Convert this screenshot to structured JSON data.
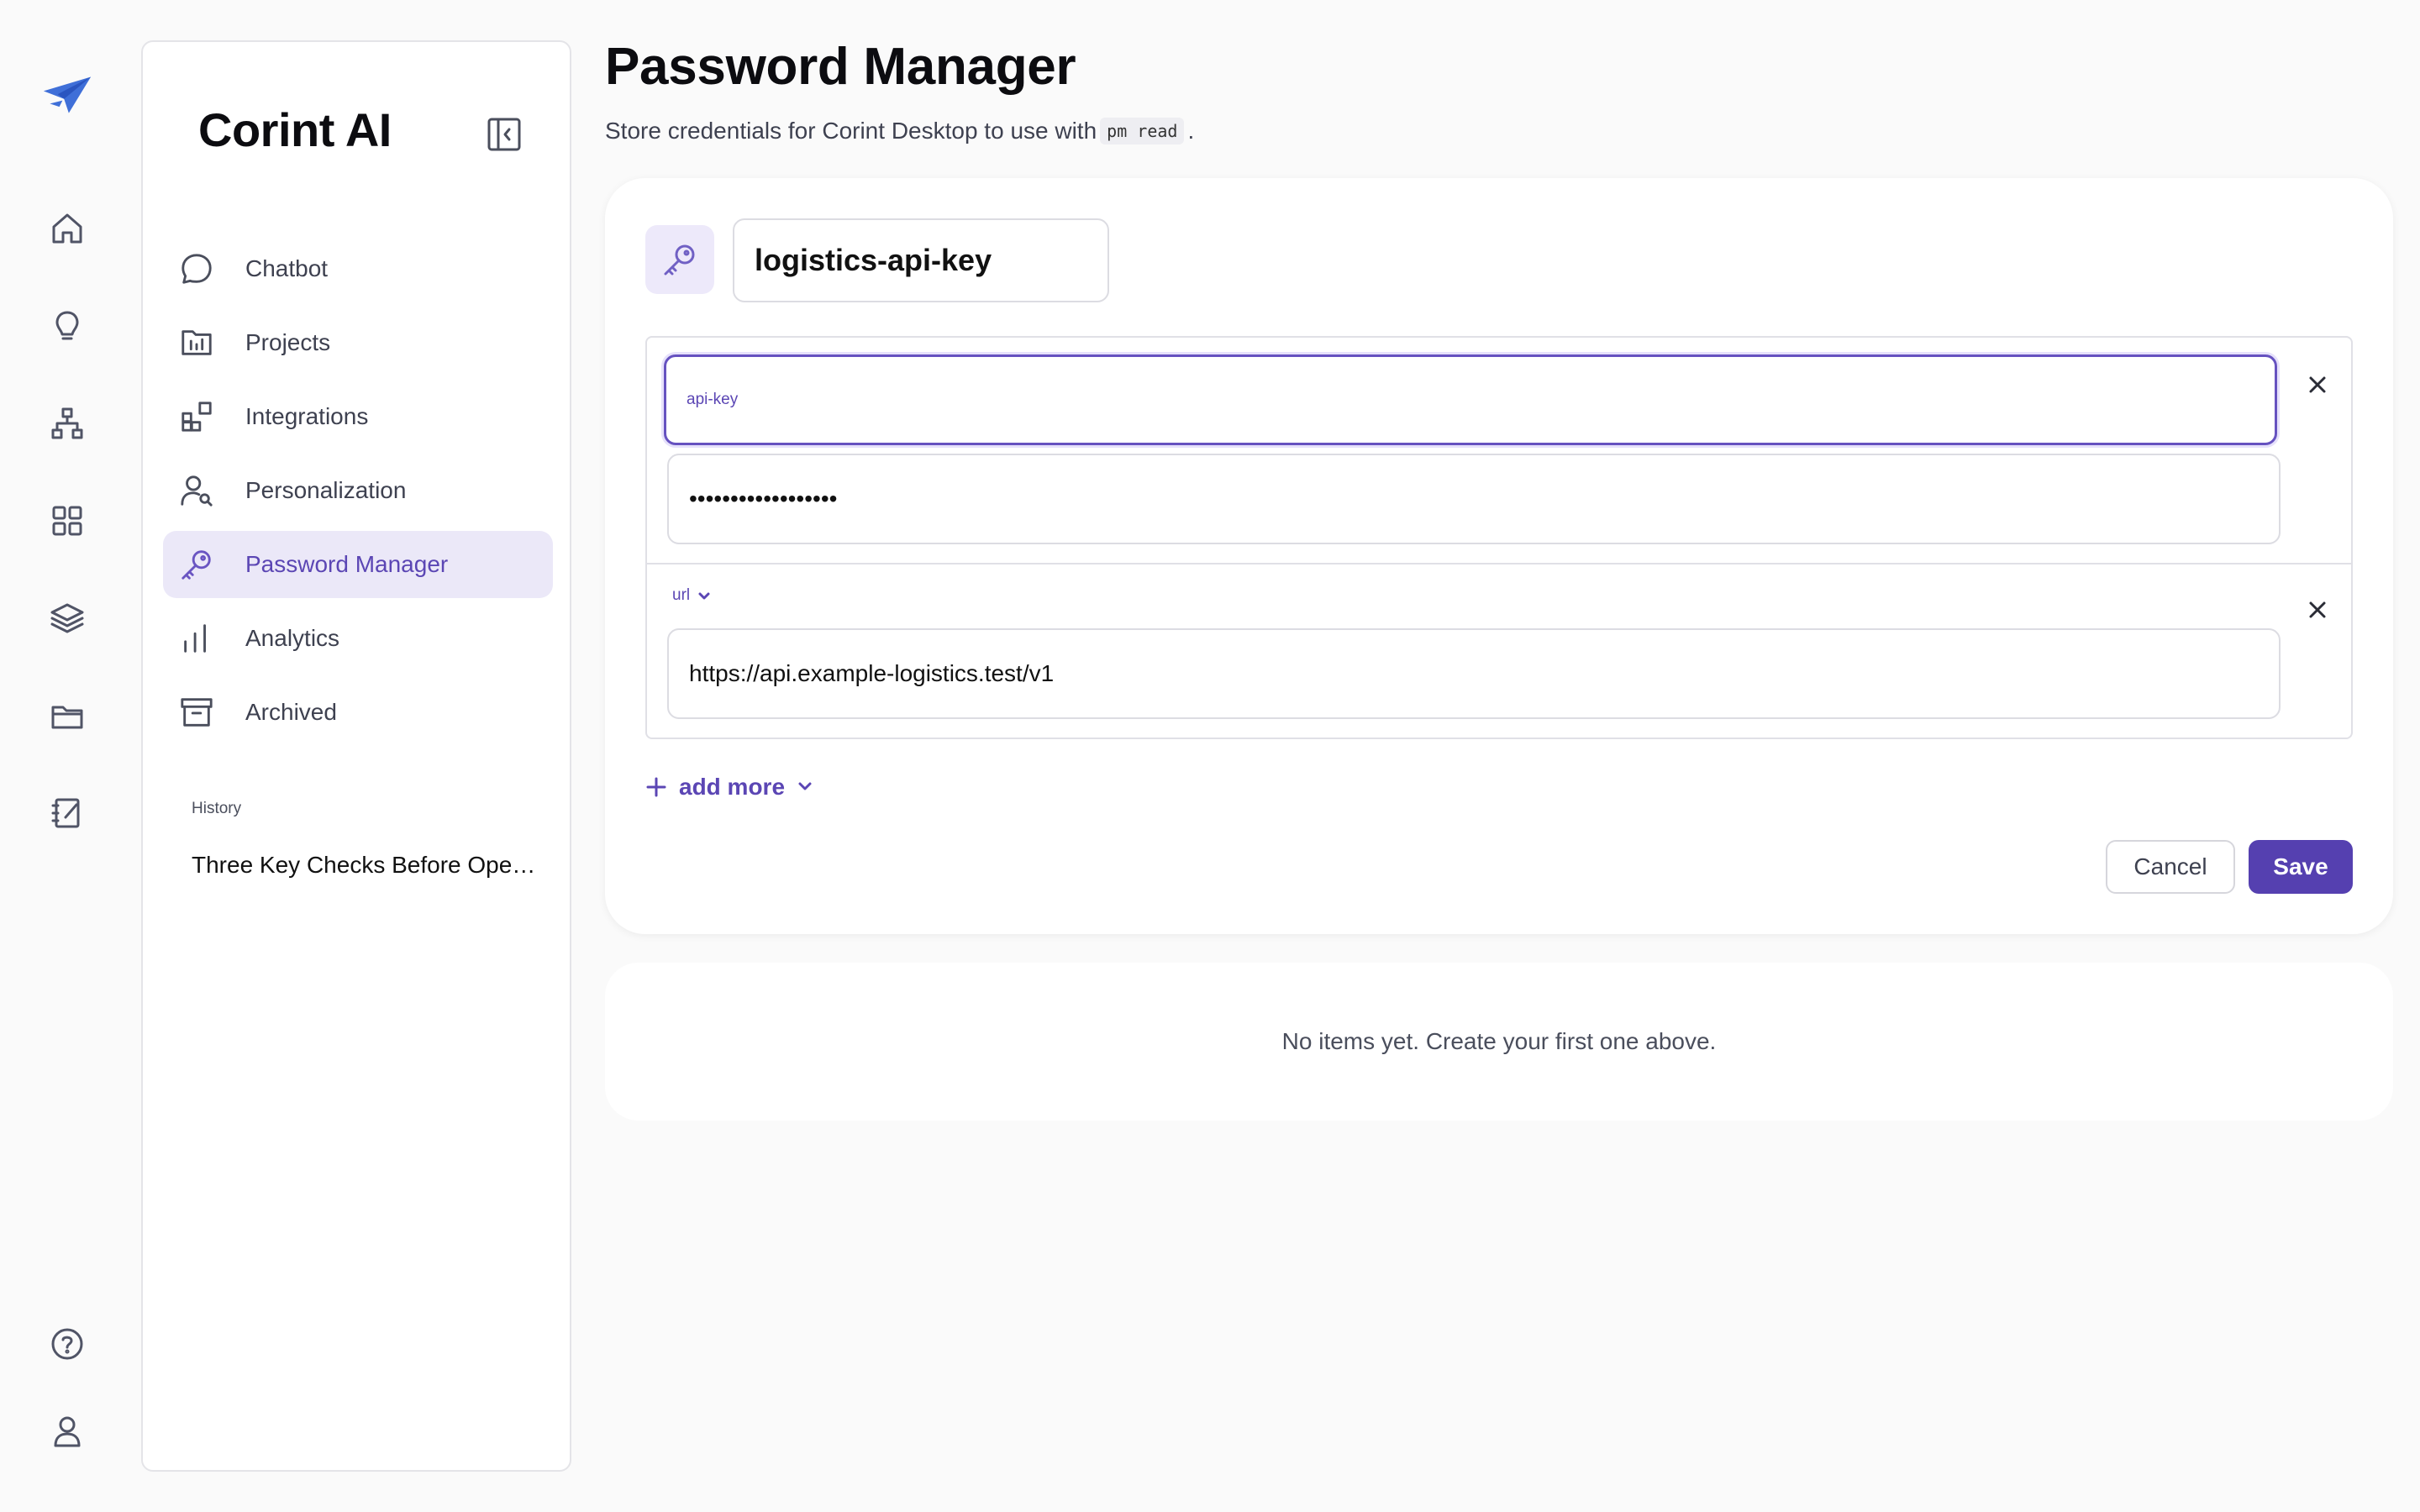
{
  "app": {
    "name": "Corint AI"
  },
  "rail": {
    "icons": [
      "logo-icon",
      "home-icon",
      "lightbulb-icon",
      "hierarchy-icon",
      "grid-icon",
      "layers-icon",
      "folder-icon",
      "notebook-icon",
      "help-icon",
      "user-icon"
    ]
  },
  "sidebar": {
    "items": [
      {
        "label": "Chatbot",
        "icon": "chat-bubble-icon"
      },
      {
        "label": "Projects",
        "icon": "folder-chart-icon"
      },
      {
        "label": "Integrations",
        "icon": "integrations-icon"
      },
      {
        "label": "Personalization",
        "icon": "user-search-icon"
      },
      {
        "label": "Password Manager",
        "icon": "key-icon",
        "active": true
      },
      {
        "label": "Analytics",
        "icon": "bar-chart-icon"
      },
      {
        "label": "Archived",
        "icon": "archive-icon"
      }
    ],
    "history_label": "History",
    "history": [
      "Three Key Checks Before Opening a New Account"
    ]
  },
  "main": {
    "title": "Password Manager",
    "subtitle_prefix": "Store credentials for Corint Desktop to use with",
    "subtitle_code": "pm read",
    "subtitle_suffix": "."
  },
  "editor": {
    "name_value": "logistics-api-key",
    "fields": [
      {
        "label": "api-key",
        "value": "••••••••••••••••••"
      },
      {
        "type": "url",
        "value": "https://api.example-logistics.test/v1"
      }
    ],
    "add_more_label": "add more",
    "cancel_label": "Cancel",
    "save_label": "Save"
  },
  "empty_state": "No items yet. Create your first one above.",
  "colors": {
    "accent": "#5540b0",
    "accent_light": "#ebe8f8",
    "background": "#fafafa"
  }
}
